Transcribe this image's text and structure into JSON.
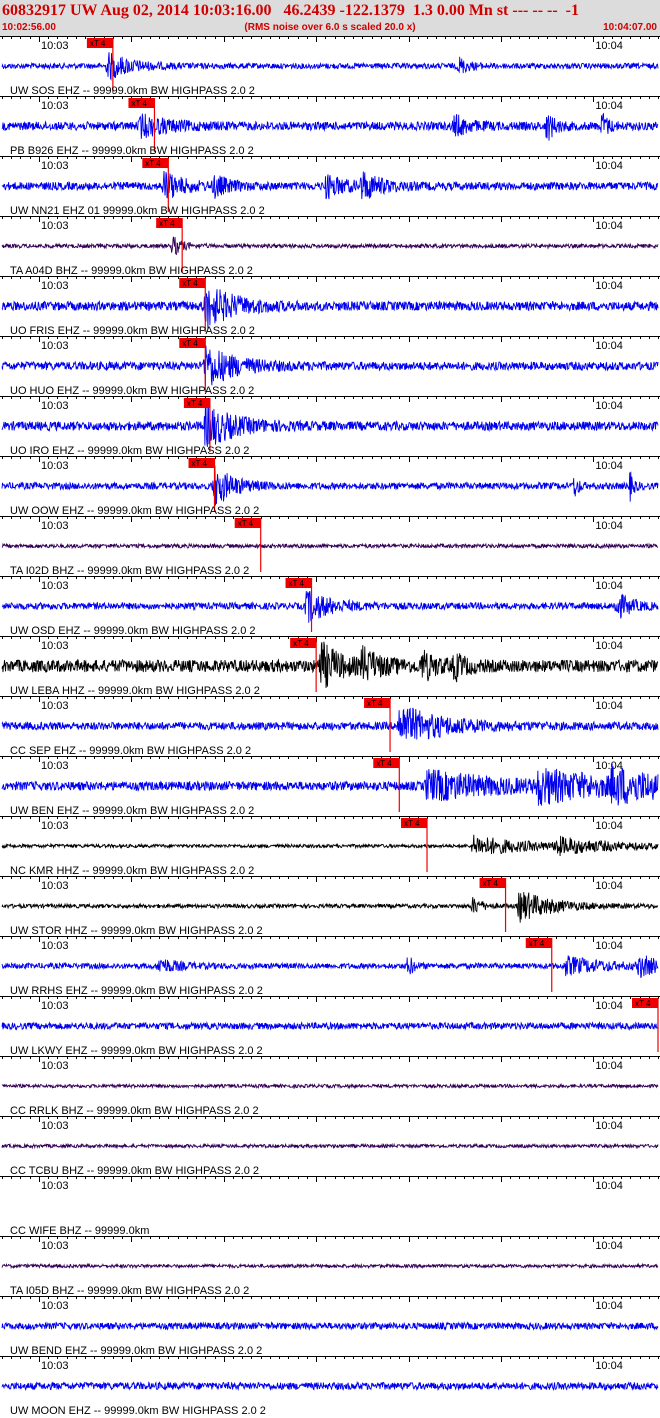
{
  "header": {
    "title": "60832917 UW Aug 02, 2014 10:03:16.00   46.2439 -122.1379  1.3 0.00 Mn st --- -- --  -1",
    "start_time": "10:02:56.00",
    "note": "(RMS noise over 6.0 s scaled 20.0 x)",
    "end_time": "10:04:07.00"
  },
  "colors": {
    "header_bg": "#dcdcdc",
    "title_text": "#d00000",
    "pick_flag": "#ee0000",
    "axis": "#000000"
  },
  "chart_data": {
    "type": "line",
    "title": "60832917 UW Aug 02, 2014 10:03:16.00   46.2439 -122.1379  1.3 0.00 Mn st --- -- --  -1",
    "xlabel": "",
    "ylabel": "",
    "x_range": [
      "10:02:56.00",
      "10:04:07.00"
    ],
    "tick_labels": [
      "10:03",
      "10:04"
    ],
    "tick_times_s": [
      4,
      64
    ],
    "pick_label": "xT 4",
    "traces": [
      {
        "label": "UW SOS EHZ -- 99999.0km BW  HIGHPASS  2.0  2",
        "color": "#0000ee",
        "pick_s": 12.0,
        "noise": 0.1,
        "events": [
          {
            "t": 11.5,
            "a": 0.45,
            "d": 2.5
          },
          {
            "t": 49.5,
            "a": 0.28,
            "d": 1.0
          }
        ]
      },
      {
        "label": "PB B926 EHZ -- 99999.0km BW  HIGHPASS  2.0  2",
        "color": "#0000ee",
        "pick_s": 16.5,
        "noise": 0.15,
        "events": [
          {
            "t": 15.0,
            "a": 0.35,
            "d": 3.0
          },
          {
            "t": 49.0,
            "a": 0.35,
            "d": 1.5
          },
          {
            "t": 59.0,
            "a": 0.5,
            "d": 0.8
          },
          {
            "t": 65.0,
            "a": 0.45,
            "d": 0.6
          },
          {
            "t": 73.0,
            "a": 0.4,
            "d": 0.8
          }
        ]
      },
      {
        "label": "UW NN21 EHZ 01 99999.0km BW  HIGHPASS  2.0  2",
        "color": "#0000ee",
        "pick_s": 18.0,
        "noise": 0.14,
        "events": [
          {
            "t": 17.5,
            "a": 0.5,
            "d": 2.0
          },
          {
            "t": 23.0,
            "a": 0.35,
            "d": 1.5
          },
          {
            "t": 35.0,
            "a": 0.4,
            "d": 2.0
          },
          {
            "t": 39.0,
            "a": 0.45,
            "d": 2.0
          }
        ]
      },
      {
        "label": "TA A04D BHZ -- 99999.0km BW  HIGHPASS  2.0  2",
        "color": "#330055",
        "pick_s": 19.5,
        "noise": 0.07,
        "events": [
          {
            "t": 18.5,
            "a": 0.35,
            "d": 1.0
          }
        ]
      },
      {
        "label": "UO FRIS EHZ -- 99999.0km BW  HIGHPASS  2.0  2",
        "color": "#0000ee",
        "pick_s": 22.0,
        "noise": 0.16,
        "events": [
          {
            "t": 22.0,
            "a": 0.75,
            "d": 3.0
          }
        ]
      },
      {
        "label": "UO HUO EHZ -- 99999.0km BW  HIGHPASS  2.0  2",
        "color": "#0000ee",
        "pick_s": 22.0,
        "noise": 0.15,
        "events": [
          {
            "t": 22.0,
            "a": 0.75,
            "d": 3.0
          }
        ]
      },
      {
        "label": "UO IRO EHZ -- 99999.0km BW  HIGHPASS  2.0  2",
        "color": "#0000ee",
        "pick_s": 22.5,
        "noise": 0.16,
        "events": [
          {
            "t": 22.0,
            "a": 0.75,
            "d": 3.0
          }
        ]
      },
      {
        "label": "UW OOW EHZ -- 99999.0km BW  HIGHPASS  2.0  2",
        "color": "#0000ee",
        "pick_s": 23.0,
        "noise": 0.12,
        "events": [
          {
            "t": 23.0,
            "a": 0.7,
            "d": 2.0
          },
          {
            "t": 62.0,
            "a": 0.4,
            "d": 0.4
          },
          {
            "t": 68.0,
            "a": 0.45,
            "d": 0.4
          }
        ]
      },
      {
        "label": "TA I02D BHZ -- 99999.0km BW  HIGHPASS  2.0  2",
        "color": "#330055",
        "pick_s": 28.0,
        "noise": 0.07,
        "events": []
      },
      {
        "label": "UW OSD EHZ -- 99999.0km BW  HIGHPASS  2.0  2",
        "color": "#0000ee",
        "pick_s": 33.5,
        "noise": 0.12,
        "events": [
          {
            "t": 33.0,
            "a": 0.55,
            "d": 2.5
          },
          {
            "t": 66.5,
            "a": 0.45,
            "d": 1.5
          }
        ]
      },
      {
        "label": "UW LEBA HHZ -- 99999.0km BW  HIGHPASS  2.0  2",
        "color": "#000000",
        "pick_s": 34.0,
        "noise": 0.22,
        "events": [
          {
            "t": 34.5,
            "a": 0.8,
            "d": 2.0
          },
          {
            "t": 39.0,
            "a": 0.5,
            "d": 2.0
          },
          {
            "t": 45.5,
            "a": 0.45,
            "d": 1.5
          },
          {
            "t": 49.0,
            "a": 0.4,
            "d": 1.0
          }
        ]
      },
      {
        "label": "CC SEP EHZ -- 99999.0km BW  HIGHPASS  2.0  2",
        "color": "#0000ee",
        "pick_s": 42.0,
        "noise": 0.14,
        "events": [
          {
            "t": 43.0,
            "a": 0.7,
            "d": 4.5
          }
        ]
      },
      {
        "label": "UW BEN EHZ -- 99999.0km BW  HIGHPASS  2.0  2",
        "color": "#0000ee",
        "pick_s": 43.0,
        "noise": 0.16,
        "events": [
          {
            "t": 46.0,
            "a": 0.5,
            "d": 8.0
          },
          {
            "t": 58.0,
            "a": 0.5,
            "d": 8.0
          },
          {
            "t": 66.0,
            "a": 0.45,
            "d": 6.0
          },
          {
            "t": 74.0,
            "a": 0.4,
            "d": 4.0
          }
        ]
      },
      {
        "label": "NC KMR HHZ -- 99999.0km BW  HIGHPASS  2.0  2",
        "color": "#000000",
        "pick_s": 46.0,
        "noise": 0.06,
        "events": [
          {
            "t": 51.0,
            "a": 0.35,
            "d": 6.0
          },
          {
            "t": 60.0,
            "a": 0.25,
            "d": 6.0
          }
        ]
      },
      {
        "label": "UW STOR HHZ -- 99999.0km BW  HIGHPASS  2.0  2",
        "color": "#000000",
        "pick_s": 54.5,
        "noise": 0.07,
        "events": [
          {
            "t": 56.0,
            "a": 0.55,
            "d": 3.5
          },
          {
            "t": 51.0,
            "a": 0.3,
            "d": 1.0
          }
        ]
      },
      {
        "label": "UW RRHS EHZ -- 99999.0km BW  HIGHPASS  2.0  2",
        "color": "#0000ee",
        "pick_s": 59.5,
        "noise": 0.1,
        "events": [
          {
            "t": 17.0,
            "a": 0.25,
            "d": 2.0
          },
          {
            "t": 44.0,
            "a": 0.4,
            "d": 0.5
          },
          {
            "t": 61.0,
            "a": 0.3,
            "d": 4.0
          },
          {
            "t": 69.0,
            "a": 0.35,
            "d": 2.0
          }
        ]
      },
      {
        "label": "UW LKWY EHZ -- 99999.0km BW  HIGHPASS  2.0  2",
        "color": "#0000ee",
        "pick_s": 71.0,
        "noise": 0.12,
        "events": [
          {
            "t": 73.0,
            "a": 0.6,
            "d": 3.5
          }
        ]
      },
      {
        "label": "CC RRLK BHZ -- 99999.0km BW  HIGHPASS  2.0  2",
        "color": "#330055",
        "pick_s": null,
        "noise": 0.06,
        "events": []
      },
      {
        "label": "CC TCBU BHZ -- 99999.0km BW  HIGHPASS  2.0  2",
        "color": "#330055",
        "pick_s": null,
        "noise": 0.06,
        "events": []
      },
      {
        "label": "CC WIFE BHZ -- 99999.0km",
        "color": "#000000",
        "pick_s": null,
        "noise": 0.0,
        "events": []
      },
      {
        "label": "TA I05D BHZ -- 99999.0km BW  HIGHPASS  2.0  2",
        "color": "#330055",
        "pick_s": null,
        "noise": 0.06,
        "events": []
      },
      {
        "label": "UW BEND EHZ -- 99999.0km BW  HIGHPASS  2.0  2",
        "color": "#0000ee",
        "pick_s": null,
        "noise": 0.12,
        "events": []
      },
      {
        "label": "UW MOON EHZ -- 99999.0km BW  HIGHPASS  2.0  2",
        "color": "#0000ee",
        "pick_s": null,
        "noise": 0.13,
        "events": []
      }
    ]
  }
}
